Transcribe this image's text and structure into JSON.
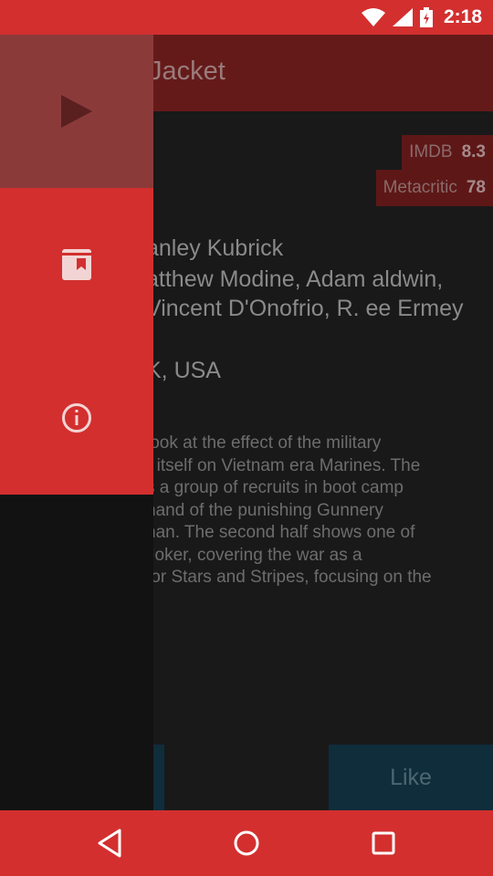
{
  "status_bar": {
    "time": "2:18",
    "icons": [
      "wifi-icon",
      "cell-signal-icon",
      "battery-icon"
    ]
  },
  "toolbar": {
    "title": "Jacket"
  },
  "ratings": {
    "imdb": {
      "label": "IMDB",
      "value": "8.3"
    },
    "metacritic": {
      "label": "Metacritic",
      "value": "78"
    }
  },
  "details": {
    "director": "anley Kubrick",
    "cast": "atthew Modine, Adam aldwin, Vincent D'Onofrio, R. ee Ermey",
    "country": "K, USA",
    "plot_lines": [
      "look at the effect of the military",
      "r itself on Vietnam era Marines. The",
      "s a group of recruits in boot camp",
      "nand of the punishing Gunnery",
      "nan. The second half shows one of",
      "Joker, covering the war as a",
      "for Stars and Stripes, focusing on the"
    ]
  },
  "actions": {
    "like_label": "Like"
  },
  "drawer": {
    "items": [
      {
        "icon": "play-icon"
      },
      {
        "icon": "bookmark-icon"
      },
      {
        "icon": "info-icon"
      }
    ]
  },
  "nav_bar": {
    "icons": [
      "back-icon",
      "home-icon",
      "recents-icon"
    ]
  },
  "colors": {
    "accent": "#d32f2f",
    "toolbar": "#651a1a",
    "button": "#0f2d3b"
  }
}
